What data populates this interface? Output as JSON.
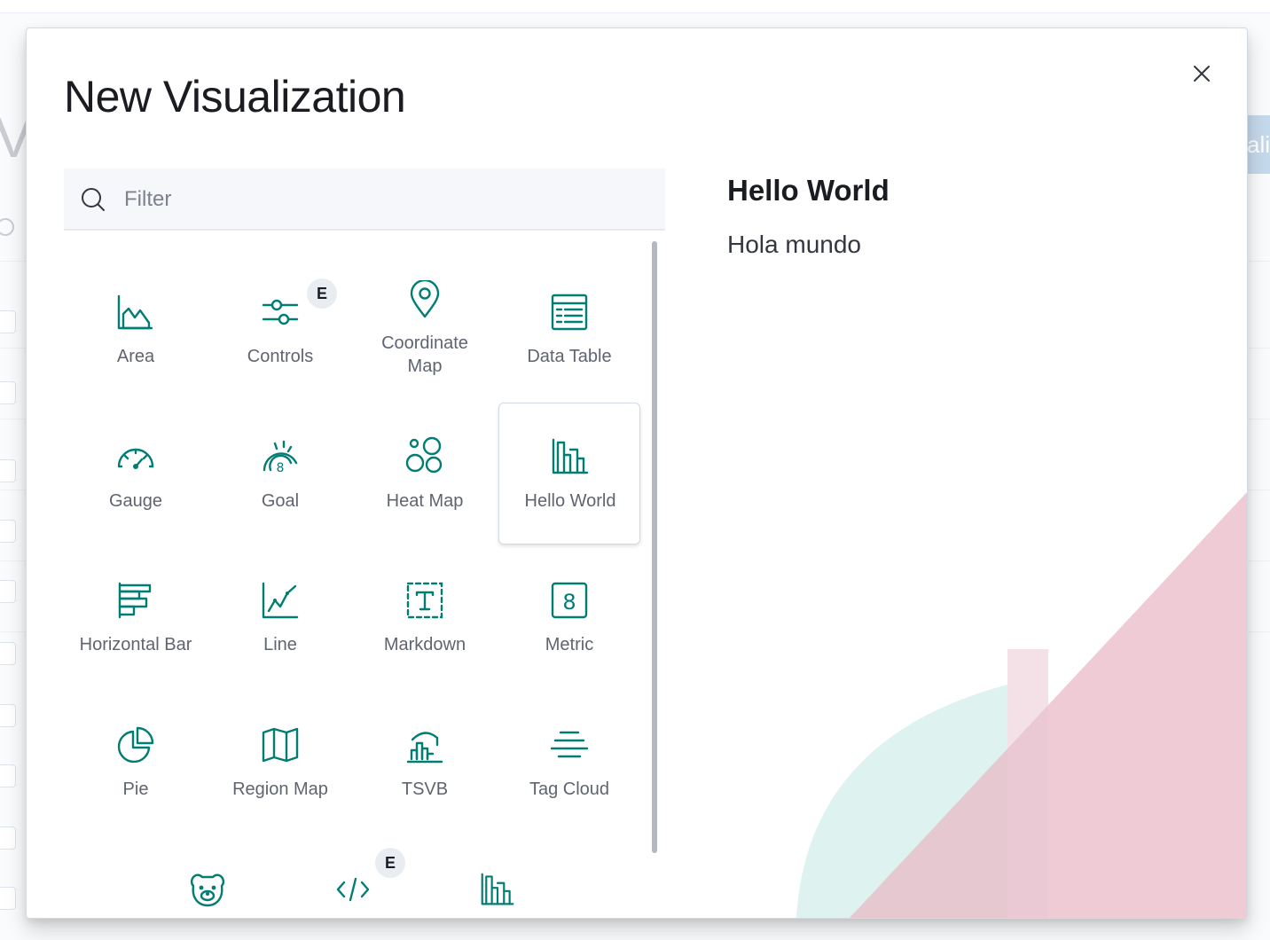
{
  "background": {
    "page_title": "Vi",
    "button_label": "ali"
  },
  "modal": {
    "title": "New Visualization",
    "search": {
      "placeholder": "Filter",
      "value": ""
    },
    "items": [
      {
        "label": "Area",
        "icon": "area-chart-icon"
      },
      {
        "label": "Controls",
        "icon": "controls-icon",
        "badge": "E"
      },
      {
        "label": "Coordinate Map",
        "icon": "map-pin-icon"
      },
      {
        "label": "Data Table",
        "icon": "data-table-icon"
      },
      {
        "label": "Gauge",
        "icon": "gauge-icon"
      },
      {
        "label": "Goal",
        "icon": "goal-icon"
      },
      {
        "label": "Heat Map",
        "icon": "heat-map-icon"
      },
      {
        "label": "Hello World",
        "icon": "hello-world-icon",
        "selected": true
      },
      {
        "label": "Horizontal Bar",
        "icon": "horizontal-bar-icon"
      },
      {
        "label": "Line",
        "icon": "line-chart-icon"
      },
      {
        "label": "Markdown",
        "icon": "markdown-icon"
      },
      {
        "label": "Metric",
        "icon": "metric-icon"
      },
      {
        "label": "Pie",
        "icon": "pie-chart-icon"
      },
      {
        "label": "Region Map",
        "icon": "region-map-icon"
      },
      {
        "label": "TSVB",
        "icon": "tsvb-icon"
      },
      {
        "label": "Tag Cloud",
        "icon": "tag-cloud-icon"
      }
    ],
    "promos": [
      {
        "icon": "bear-icon"
      },
      {
        "icon": "code-icon",
        "badge": "E"
      },
      {
        "icon": "hello-world-icon"
      }
    ],
    "description": {
      "title": "Hello World",
      "text": "Hola mundo"
    }
  },
  "colors": {
    "accent": "#017d73",
    "decor_pink": "#e8b9c7",
    "decor_teal": "#d3ede9"
  }
}
